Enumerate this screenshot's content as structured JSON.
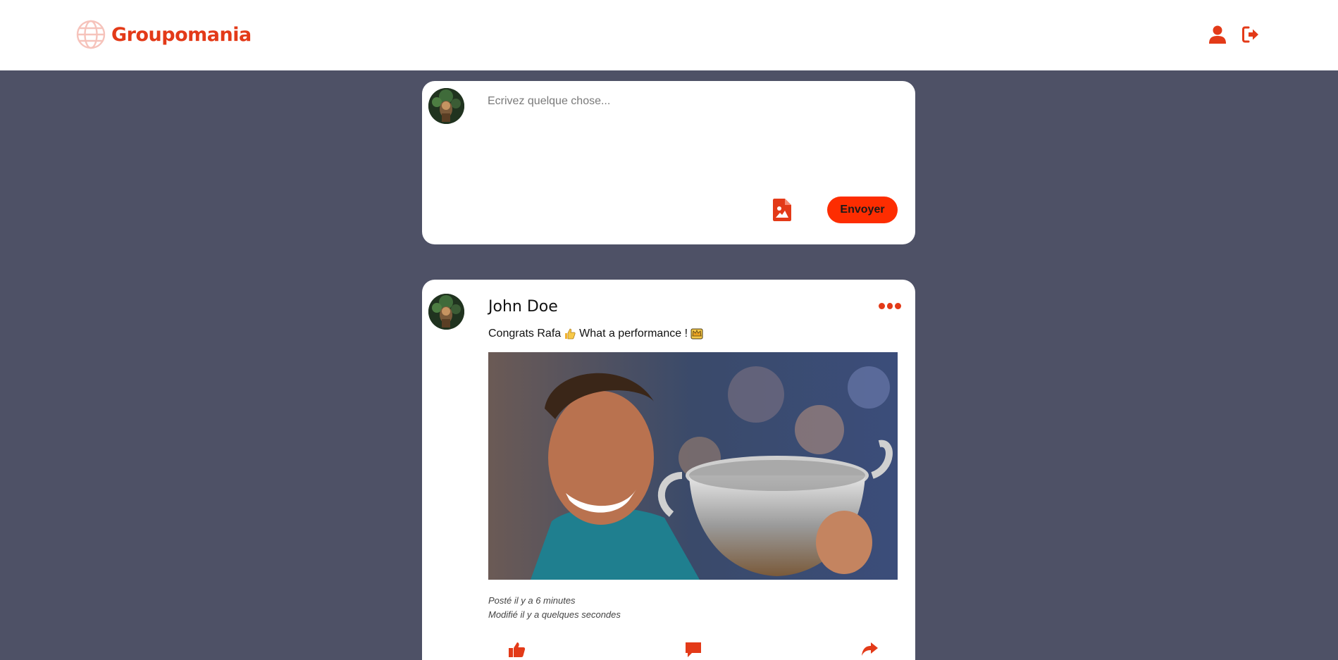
{
  "header": {
    "brand_name": "Groupomania",
    "brand_logo_icon": "globe-icon",
    "profile_icon": "user-icon",
    "logout_icon": "sign-out-icon",
    "accent_color": "#e33a18"
  },
  "composer": {
    "placeholder": "Ecrivez quelque chose...",
    "file_icon": "file-image-icon",
    "send_label": "Envoyer",
    "send_button_color": "#fd2d01"
  },
  "post": {
    "author": "John Doe",
    "text": "Congrats Rafa",
    "text_middle": "What a performance !",
    "emoji_1": "thumbs-up-emoji",
    "emoji_2": "crown-emoji",
    "posted": "Posté il y a 6 minutes",
    "modified": "Modifié il y a quelques secondes",
    "menu_icon": "ellipsis-icon",
    "actions": [
      {
        "icon": "thumbs-up-icon"
      },
      {
        "icon": "comment-icon"
      },
      {
        "icon": "share-icon"
      }
    ]
  },
  "page": {
    "background_color": "#4e5166"
  }
}
